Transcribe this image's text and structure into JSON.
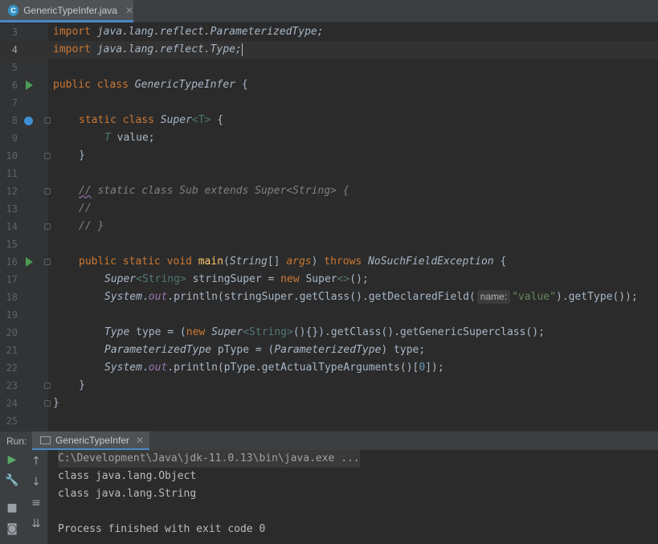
{
  "editor_tab": {
    "label": "GenericTypeInfer.java",
    "close": "✕",
    "icon": "java-class-icon"
  },
  "lines": [
    {
      "n": "3"
    },
    {
      "n": "4"
    },
    {
      "n": "5"
    },
    {
      "n": "6"
    },
    {
      "n": "7"
    },
    {
      "n": "8"
    },
    {
      "n": "9"
    },
    {
      "n": "10"
    },
    {
      "n": "11"
    },
    {
      "n": "12"
    },
    {
      "n": "13"
    },
    {
      "n": "14"
    },
    {
      "n": "15"
    },
    {
      "n": "16"
    },
    {
      "n": "17"
    },
    {
      "n": "18"
    },
    {
      "n": "19"
    },
    {
      "n": "20"
    },
    {
      "n": "21"
    },
    {
      "n": "22"
    },
    {
      "n": "23"
    },
    {
      "n": "24"
    },
    {
      "n": "25"
    }
  ],
  "code": {
    "l3_kw": "import",
    "l3_rest": " java.lang.reflect.ParameterizedType;",
    "l4_kw": "import",
    "l4_rest": " java.lang.reflect.Type;",
    "l6_kw1": "public",
    "l6_kw2": " class",
    "l6_name": " GenericTypeInfer",
    "l6_brace": " {",
    "l8_kw1": "static",
    "l8_kw2": " class",
    "l8_name": " Super",
    "l8_tp": "<T>",
    "l8_brace": " {",
    "l9_t": "T",
    "l9_rest": " value;",
    "l10": "}",
    "l12_slash": "//",
    "l12_rest": " static class Sub extends Super<String> {",
    "l13": "//",
    "l14": "// }",
    "l16_kw": "public static void",
    "l16_name": " main",
    "l16_p1": "(",
    "l16_str": "String",
    "l16_p2": "[] ",
    "l16_args": "args",
    "l16_p3": ") ",
    "l16_throws": "throws",
    "l16_ex": " NoSuchFieldException",
    "l16_brace": " {",
    "l17_a": "Super",
    "l17_b": "<String>",
    "l17_c": " stringSuper = ",
    "l17_new": "new",
    "l17_d": " Super",
    "l17_e": "<>",
    "l17_f": "();",
    "l18_sys": "System",
    "l18_dot": ".",
    "l18_out": "out",
    "l18_a": ".println(stringSuper.getClass().getDeclaredField(",
    "l18_hint": "name:",
    "l18_str": "\"value\"",
    "l18_b": ").getType());",
    "l20_type": "Type",
    "l20_a": " type = (",
    "l20_new": "new",
    "l20_super": " Super",
    "l20_gen": "<String>",
    "l20_b": "(){}).getClass().getGenericSuperclass();",
    "l21_pt": "ParameterizedType",
    "l21_a": " pType = (",
    "l21_pt2": "ParameterizedType",
    "l21_b": ") type;",
    "l22_sys": "System",
    "l22_dot": ".",
    "l22_out": "out",
    "l22_a": ".println(pType.getActualTypeArguments()[",
    "l22_num": "0",
    "l22_b": "]);",
    "l23": "}",
    "l24": "}"
  },
  "run_panel": {
    "title": "Run:",
    "tab_label": "GenericTypeInfer",
    "tab_close": "✕",
    "tools_left": [
      "play-icon",
      "wrench-icon",
      "stop-icon",
      "camera-icon"
    ],
    "tools_right": [
      "arrow-up-icon",
      "arrow-down-icon",
      "soft-wrap-icon",
      "scroll-to-end-icon"
    ]
  },
  "console": {
    "cmd": "C:\\Development\\Java\\jdk-11.0.13\\bin\\java.exe ...",
    "out1": "class java.lang.Object",
    "out2": "class java.lang.String",
    "exit": "Process finished with exit code 0"
  },
  "colors": {
    "keyword": "#cc7832",
    "string": "#6a8759",
    "field": "#9876aa",
    "type_param": "#507874",
    "comment": "#808080",
    "run_green": "#499c54"
  }
}
